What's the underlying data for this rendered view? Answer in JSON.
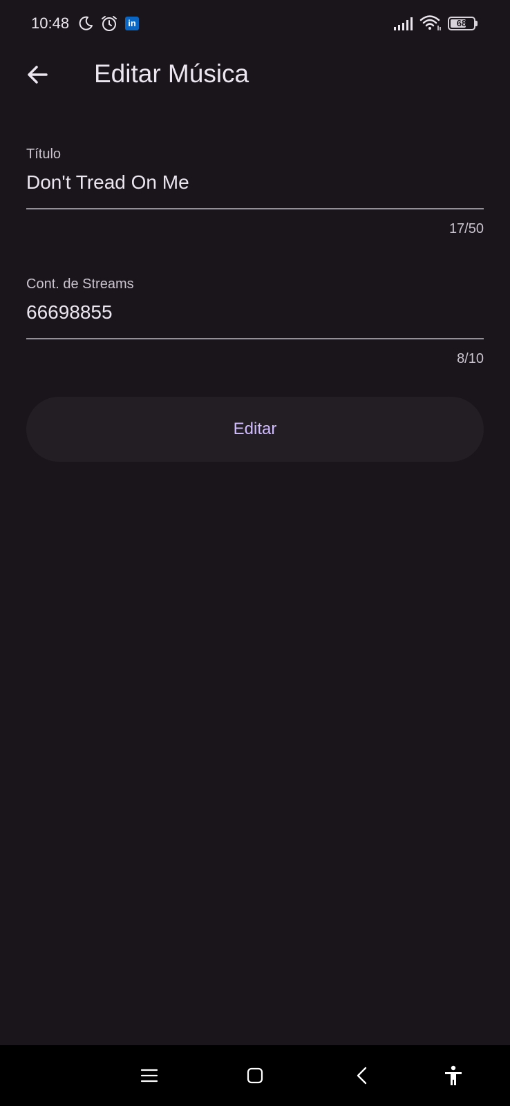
{
  "status_bar": {
    "time": "10:48",
    "icons": [
      "moon-icon",
      "alarm-icon",
      "linkedin-icon",
      "signal-icon",
      "wifi-icon"
    ],
    "linkedin_text": "in",
    "battery_level": "68",
    "battery_fraction": 0.68
  },
  "app_bar": {
    "back_icon": "arrow-left-icon",
    "title": "Editar Música"
  },
  "form": {
    "title_field": {
      "label": "Título",
      "value": "Don't Tread On Me",
      "counter": "17/50"
    },
    "streams_field": {
      "label": "Cont. de Streams",
      "value": "66698855",
      "counter": "8/10"
    },
    "submit_label": "Editar"
  },
  "nav_bar": {
    "icons": [
      "menu-icon",
      "home-icon",
      "back-icon",
      "accessibility-icon"
    ]
  },
  "colors": {
    "background": "#19151b",
    "text": "#ece6f0",
    "secondary_text": "#cbc4cf",
    "accent": "#d0bcff",
    "button_bg": "#221e24",
    "underline": "#938f99",
    "linkedin": "#0a66c2"
  }
}
